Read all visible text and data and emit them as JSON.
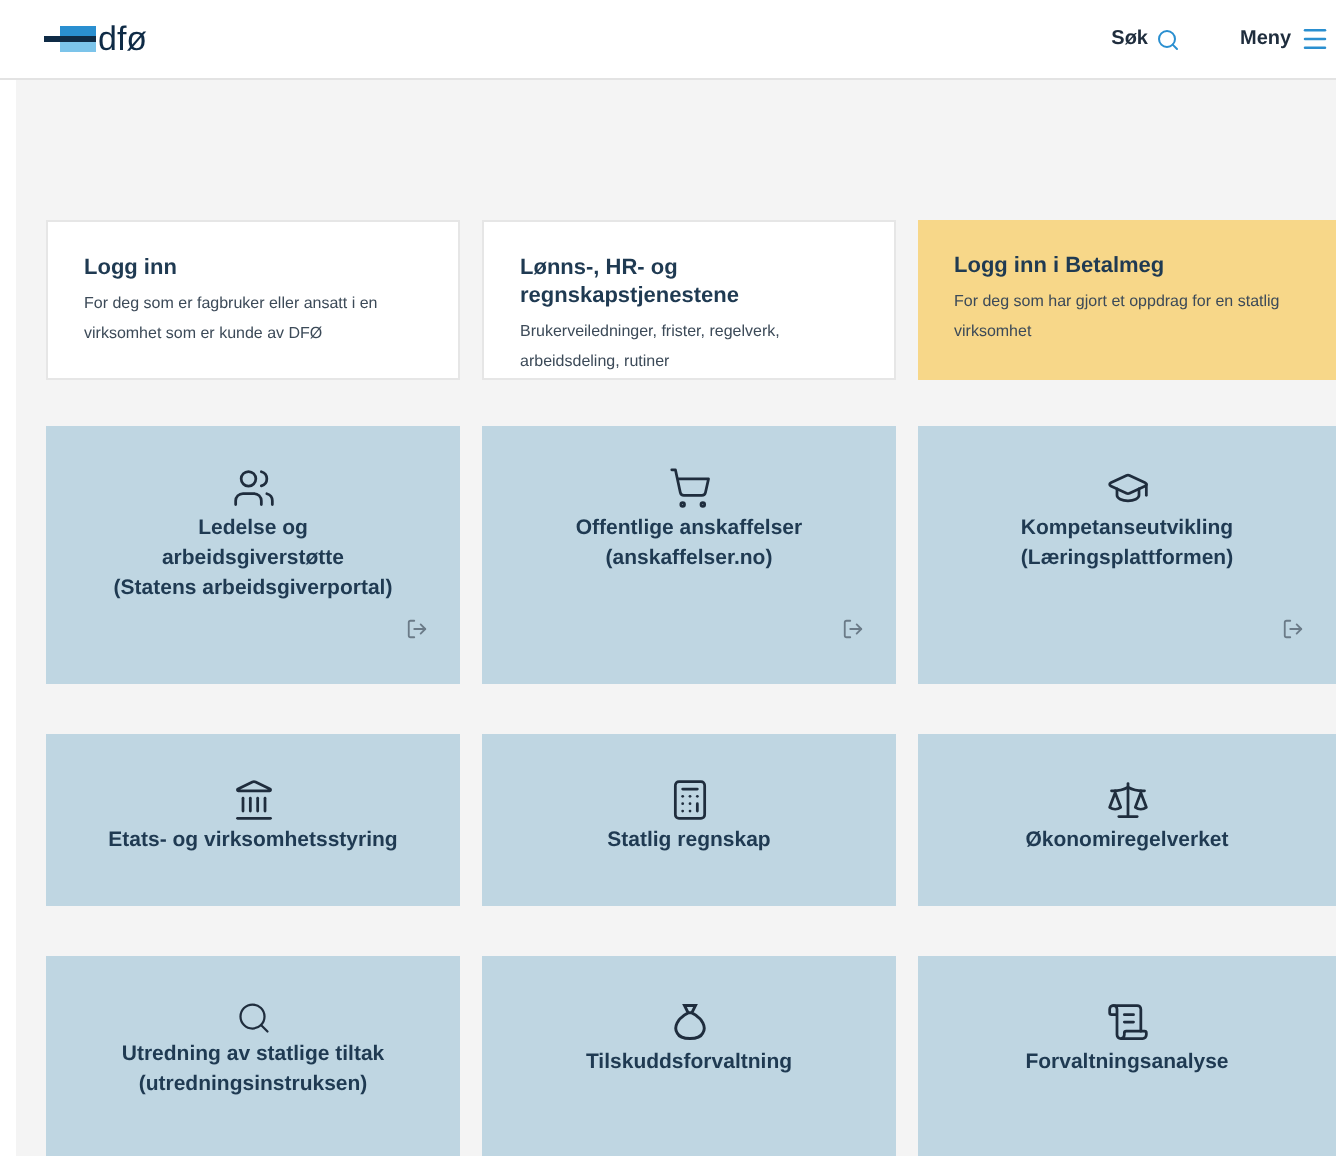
{
  "header": {
    "logo_text": "dfø",
    "search_label": "Søk",
    "menu_label": "Meny"
  },
  "top_cards": [
    {
      "title": "Logg inn",
      "text": "For deg som er fagbruker eller ansatt i en virksomhet som er kunde av DFØ",
      "highlighted": false
    },
    {
      "title": "Lønns-, HR- og regnskapstjenestene",
      "text": "Brukerveiledninger, frister, regelverk, arbeidsdeling, rutiner",
      "highlighted": false
    },
    {
      "title": "Logg inn i Betalmeg",
      "text": "For deg som har gjort et oppdrag for en statlig virksomhet",
      "highlighted": true
    }
  ],
  "tiles": [
    {
      "title": "Ledelse og\narbeidsgiverstøtte\n(Statens arbeidsgiverportal)",
      "external": true
    },
    {
      "title": "Offentlige anskaffelser\n(anskaffelser.no)",
      "external": true
    },
    {
      "title": "Kompetanseutvikling\n(Læringsplattformen)",
      "external": true
    },
    {
      "title": "Etats- og virksomhetsstyring",
      "external": false
    },
    {
      "title": "Statlig regnskap",
      "external": false
    },
    {
      "title": "Økonomiregelverket",
      "external": false
    },
    {
      "title": "Utredning av statlige tiltak\n(utredningsinstruksen)",
      "external": false
    },
    {
      "title": "Tilskuddsforvaltning",
      "external": false
    },
    {
      "title": "Forvaltningsanalyse",
      "external": false
    }
  ]
}
